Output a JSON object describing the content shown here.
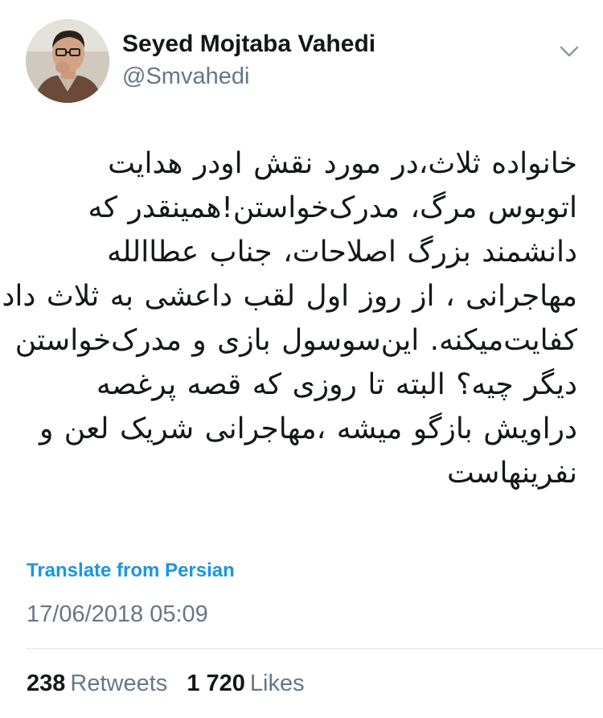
{
  "user": {
    "display_name": "Seyed Mojtaba Vahedi",
    "handle": "@Smvahedi",
    "avatar_icon": "profile-photo"
  },
  "menu": {
    "icon": "chevron-down-icon"
  },
  "tweet": {
    "lines": [
      "خانواده ثلاث،در مورد نقش اودر هدایت",
      "اتوبوس مرگ، مدرک‌خواستن!همینقدر که",
      "دانشمند بزرگ اصلاحات، جناب عطاالله",
      "مهاجرانی ، از روز اول لقب داعشی به ثلاث داد",
      "کفایت‌میکنه. این‌سوسول بازی و مدرک‌خواستن",
      "دیگر چیه؟ البته تا روزی که قصه پرغصه",
      "دراویش بازگو میشه ،مهاجرانی شریک لعن و",
      "نفرینهاست"
    ],
    "translate_label": "Translate from Persian",
    "timestamp": "17/06/2018 05:09"
  },
  "stats": {
    "retweets_count": "238",
    "retweets_label": "Retweets",
    "likes_count": "1 720",
    "likes_label": "Likes"
  },
  "colors": {
    "link": "#1b95e0",
    "secondary_text": "#657786",
    "primary_text": "#14171a",
    "divider": "#e1e8ed"
  }
}
